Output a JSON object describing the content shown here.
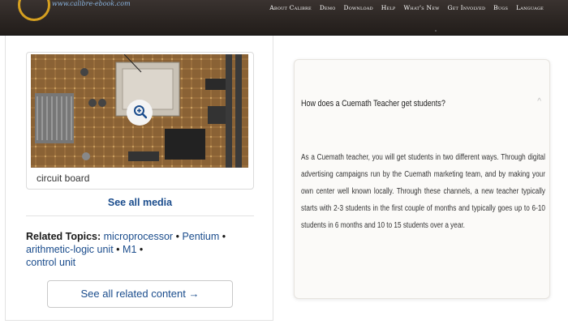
{
  "nav": {
    "logo_text": "www.calibre-ebook.com",
    "links": [
      "About Calibre",
      "Demo",
      "Download",
      "Help",
      "What's New",
      "Get Involved",
      "Bugs",
      "Language"
    ]
  },
  "media": {
    "caption": "circuit board",
    "see_all_label": "See all media",
    "zoom_icon": "magnifier-plus-icon"
  },
  "related": {
    "heading": "Related Topics:",
    "topics": [
      "microprocessor",
      "Pentium",
      "arithmetic-logic unit",
      "M1",
      "control unit"
    ],
    "separator": "•",
    "see_all_label": "See all related content →"
  },
  "faq": {
    "question": "How does a Cuemath Teacher get students?",
    "toggle": "^",
    "answer": "As a Cuemath teacher, you will get students in two different ways. Through digital advertising campaigns run by the Cuemath marketing team, and by making your own center well known locally. Through these channels, a new teacher typically starts with 2-3 students in the first couple of months and typically goes up to 6-10 students in 6 months and 10 to 15 students over a year."
  },
  "colors": {
    "navbar": "#2b2522",
    "link_blue": "#1a4c8c",
    "logo_gold": "#d6a020"
  }
}
